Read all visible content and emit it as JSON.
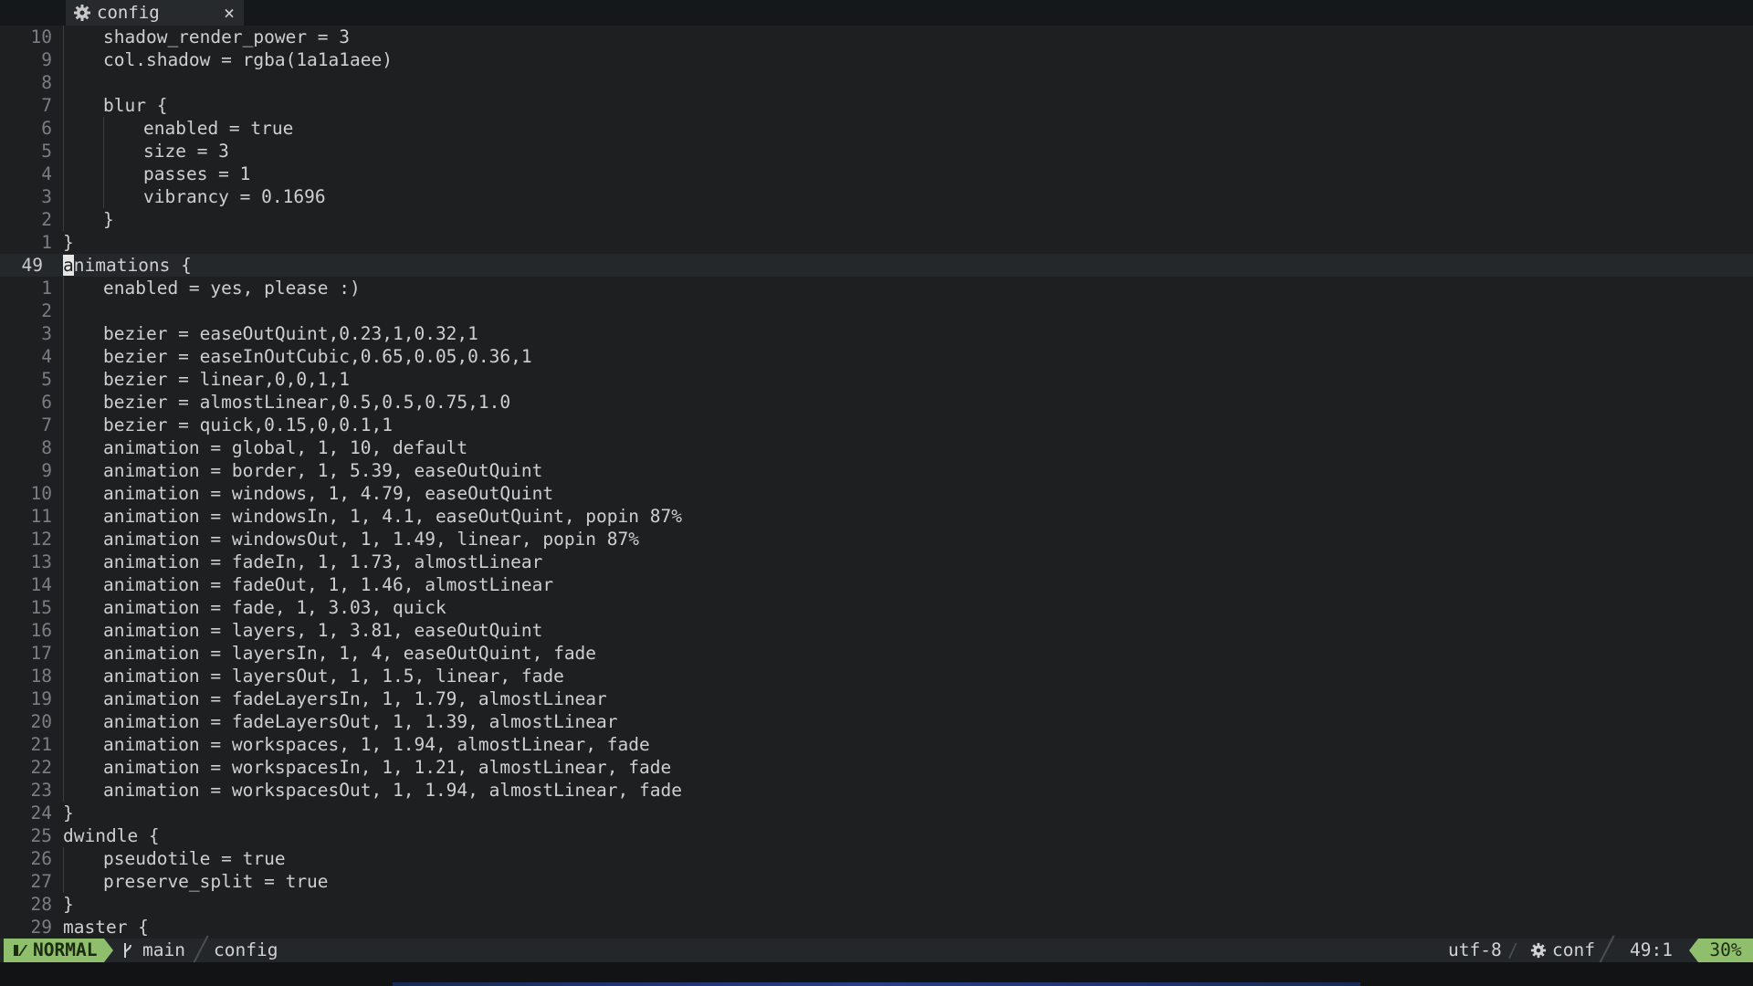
{
  "tab": {
    "label": "config",
    "icon": "gear-icon",
    "close": "×"
  },
  "editor": {
    "cursor_char": "a",
    "lines": [
      {
        "num": "10",
        "indent": 1,
        "text": "shadow_render_power = 3"
      },
      {
        "num": "9",
        "indent": 1,
        "text": "col.shadow = rgba(1a1a1aee)"
      },
      {
        "num": "8",
        "indent": 0,
        "text": ""
      },
      {
        "num": "7",
        "indent": 1,
        "text": "blur {"
      },
      {
        "num": "6",
        "indent": 2,
        "text": "enabled = true"
      },
      {
        "num": "5",
        "indent": 2,
        "text": "size = 3"
      },
      {
        "num": "4",
        "indent": 2,
        "text": "passes = 1"
      },
      {
        "num": "3",
        "indent": 2,
        "text": "vibrancy = 0.1696"
      },
      {
        "num": "2",
        "indent": 1,
        "text": "}"
      },
      {
        "num": "1",
        "indent": 0,
        "text": "}"
      },
      {
        "num": "49",
        "indent": 0,
        "text": "nimations {",
        "current": true
      },
      {
        "num": "1",
        "indent": 1,
        "text": "enabled = yes, please :)"
      },
      {
        "num": "2",
        "indent": 0,
        "text": ""
      },
      {
        "num": "3",
        "indent": 1,
        "text": "bezier = easeOutQuint,0.23,1,0.32,1"
      },
      {
        "num": "4",
        "indent": 1,
        "text": "bezier = easeInOutCubic,0.65,0.05,0.36,1"
      },
      {
        "num": "5",
        "indent": 1,
        "text": "bezier = linear,0,0,1,1"
      },
      {
        "num": "6",
        "indent": 1,
        "text": "bezier = almostLinear,0.5,0.5,0.75,1.0"
      },
      {
        "num": "7",
        "indent": 1,
        "text": "bezier = quick,0.15,0,0.1,1"
      },
      {
        "num": "8",
        "indent": 1,
        "text": "animation = global, 1, 10, default"
      },
      {
        "num": "9",
        "indent": 1,
        "text": "animation = border, 1, 5.39, easeOutQuint"
      },
      {
        "num": "10",
        "indent": 1,
        "text": "animation = windows, 1, 4.79, easeOutQuint"
      },
      {
        "num": "11",
        "indent": 1,
        "text": "animation = windowsIn, 1, 4.1, easeOutQuint, popin 87%"
      },
      {
        "num": "12",
        "indent": 1,
        "text": "animation = windowsOut, 1, 1.49, linear, popin 87%"
      },
      {
        "num": "13",
        "indent": 1,
        "text": "animation = fadeIn, 1, 1.73, almostLinear"
      },
      {
        "num": "14",
        "indent": 1,
        "text": "animation = fadeOut, 1, 1.46, almostLinear"
      },
      {
        "num": "15",
        "indent": 1,
        "text": "animation = fade, 1, 3.03, quick"
      },
      {
        "num": "16",
        "indent": 1,
        "text": "animation = layers, 1, 3.81, easeOutQuint"
      },
      {
        "num": "17",
        "indent": 1,
        "text": "animation = layersIn, 1, 4, easeOutQuint, fade"
      },
      {
        "num": "18",
        "indent": 1,
        "text": "animation = layersOut, 1, 1.5, linear, fade"
      },
      {
        "num": "19",
        "indent": 1,
        "text": "animation = fadeLayersIn, 1, 1.79, almostLinear"
      },
      {
        "num": "20",
        "indent": 1,
        "text": "animation = fadeLayersOut, 1, 1.39, almostLinear"
      },
      {
        "num": "21",
        "indent": 1,
        "text": "animation = workspaces, 1, 1.94, almostLinear, fade"
      },
      {
        "num": "22",
        "indent": 1,
        "text": "animation = workspacesIn, 1, 1.21, almostLinear, fade"
      },
      {
        "num": "23",
        "indent": 1,
        "text": "animation = workspacesOut, 1, 1.94, almostLinear, fade"
      },
      {
        "num": "24",
        "indent": 0,
        "text": "}"
      },
      {
        "num": "25",
        "indent": 0,
        "text": "dwindle {"
      },
      {
        "num": "26",
        "indent": 1,
        "text": "pseudotile = true"
      },
      {
        "num": "27",
        "indent": 1,
        "text": "preserve_split = true"
      },
      {
        "num": "28",
        "indent": 0,
        "text": "}"
      },
      {
        "num": "29",
        "indent": 0,
        "text": "master {"
      }
    ]
  },
  "statusbar": {
    "mode": "NORMAL",
    "branch": "main",
    "file": "config",
    "encoding": "utf-8",
    "separator": "/",
    "filetype": "conf",
    "position": "49:1",
    "percent": "30%"
  },
  "colors": {
    "background": "#1d1f21",
    "accent": "#8fbe6c",
    "line_number": "#7a7e82",
    "text": "#cfcfcf"
  }
}
